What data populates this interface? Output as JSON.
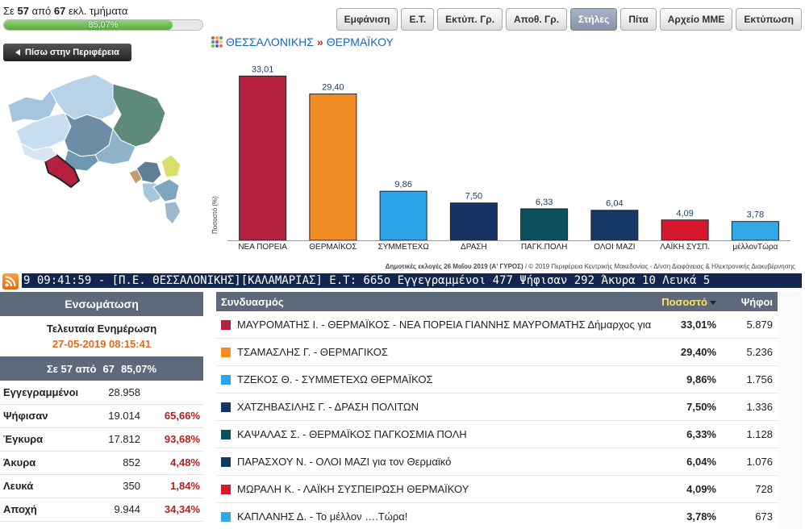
{
  "progress": {
    "prefix": "Σε",
    "counted": "57",
    "middle": "από",
    "total": "67",
    "suffix": "εκλ. τμήματα",
    "percent_label": "85,07%",
    "fraction": 0.8507
  },
  "toolbar": [
    {
      "label": "Εμφάνιση",
      "active": false
    },
    {
      "label": "Ε.Τ.",
      "active": false
    },
    {
      "label": "Εκτύπ. Γρ.",
      "active": false
    },
    {
      "label": "Αποθ. Γρ.",
      "active": false
    },
    {
      "label": "Στήλες",
      "active": true
    },
    {
      "label": "Πίτα",
      "active": false
    },
    {
      "label": "Αρχείο ΜΜΕ",
      "active": false
    },
    {
      "label": "Εκτύπωση",
      "active": false
    }
  ],
  "back_label": "Πίσω στην Περιφέρεια",
  "breadcrumb": {
    "region": "ΘΕΣΣΑΛΟΝΙΚΗΣ",
    "sep": "»",
    "municipality": "ΘΕΡΜΑΪΚΟΥ"
  },
  "chart_data": {
    "type": "bar",
    "categories": [
      "ΝΕΑ ΠΟΡΕΙΑ",
      "ΘΕΡΜΑΪΚΟΣ",
      "ΣΥΜΜΕΤΕΧΩ",
      "ΔΡΑΣΗ",
      "ΠΑΓΚ.ΠΟΛΗ",
      "ΟΛΟΙ ΜΑΖΙ",
      "ΛΑΪΚΗ ΣΥΣΠ.",
      "μέλλονΤώρα"
    ],
    "values": [
      33.01,
      29.4,
      9.86,
      7.5,
      6.33,
      6.04,
      4.09,
      3.78
    ],
    "value_labels": [
      "33,01",
      "29,40",
      "9,86",
      "7,50",
      "6,33",
      "6,04",
      "4,09",
      "3,78"
    ],
    "colors": [
      "#b5203f",
      "#f28c25",
      "#2ea4e8",
      "#173464",
      "#0c4f5e",
      "#163867",
      "#d6182e",
      "#32a8e6"
    ],
    "ylabel": "Ποσοστό (%)",
    "ylim": [
      0,
      35
    ]
  },
  "chart_footer": {
    "bold": "Δημοτικές εκλογές 26 Μαΐου 2019 (Α' ΓΥΡΟΣ)",
    "rest": " / © 2019 Περιφέρεια Κεντρικής Μακεδονίας - Δ/νση Διαφάνειας & Ηλεκτρονικής Διακυβέρνησης"
  },
  "ticker": "9 09:41:59 - [Π.Ε. ΘΕΣΣΑΛΟΝΙΚΗΣ][ΚΑΛΑΜΑΡΙΑΣ]  Ε.Τ: 665ο  Εγγεγραμμένοι 477  Ψήφισαν 292  Άκυρα 10  Λευκά 5",
  "left_panel": {
    "title": "Ενσωμάτωση",
    "update_title": "Τελευταία Ενημέρωση",
    "update_time": "27-05-2019 08:15:41",
    "summary": {
      "a": "Σε 57 από",
      "b": "67",
      "c": "85,07%"
    },
    "rows": [
      {
        "k": "Εγγεγραμμένοι",
        "v": "28.958",
        "p": ""
      },
      {
        "k": "Ψήφισαν",
        "v": "19.014",
        "p": "65,66%"
      },
      {
        "k": "Έγκυρα",
        "v": "17.812",
        "p": "93,68%"
      },
      {
        "k": "Άκυρα",
        "v": "852",
        "p": "4,48%"
      },
      {
        "k": "Λευκά",
        "v": "350",
        "p": "1,84%"
      },
      {
        "k": "Αποχή",
        "v": "9.944",
        "p": "34,34%"
      }
    ]
  },
  "results": {
    "headers": {
      "name": "Συνδυασμός",
      "percent": "Ποσοστό",
      "votes": "Ψήφοι"
    },
    "rows": [
      {
        "name": "ΜΑΥΡΟΜΑΤΗΣ Ι. - ΘΕΡΜΑΪΚΟΣ - ΝΕΑ ΠΟΡΕΙΑ ΓΙΑΝΝΗΣ ΜΑΥΡΟΜΑΤΗΣ Δήμαρχος για",
        "percent": "33,01%",
        "votes": "5.879",
        "color": "#b5203f"
      },
      {
        "name": "ΤΣΑΜΑΣΛΗΣ Γ. - ΘΕΡΜΑΓΙΚΟΣ",
        "percent": "29,40%",
        "votes": "5.236",
        "color": "#f28c25"
      },
      {
        "name": "ΤΖΕΚΟΣ Θ. - ΣΥΜΜΕΤΕΧΩ ΘΕΡΜΑΪΚΟΣ",
        "percent": "9,86%",
        "votes": "1.756",
        "color": "#2ea4e8"
      },
      {
        "name": "ΧΑΤΖΗΒΑΣΙΛΗΣ Γ. - ΔΡΑΣΗ ΠΟΛΙΤΩΝ",
        "percent": "7,50%",
        "votes": "1.336",
        "color": "#173464"
      },
      {
        "name": "ΚΑΨΑΛΑΣ Σ. - ΘΕΡΜΑΪΚΟΣ ΠΑΓΚΟΣΜΙΑ ΠΟΛΗ",
        "percent": "6,33%",
        "votes": "1.128",
        "color": "#0c4f5e"
      },
      {
        "name": "ΠΑΡΑΣΧΟΥ Ν. - ΟΛΟΙ ΜΑΖΙ για τον Θερμαϊκό",
        "percent": "6,04%",
        "votes": "1.076",
        "color": "#163867"
      },
      {
        "name": "ΜΩΡΑΛΗ Κ. - ΛΑΪΚΗ ΣΥΣΠΕΙΡΩΣΗ ΘΕΡΜΑΪΚΟΥ",
        "percent": "4,09%",
        "votes": "728",
        "color": "#d6182e"
      },
      {
        "name": "ΚΑΠΛΑΝΗΣ Δ. - Το μέλλον ….Τώρα!",
        "percent": "3,78%",
        "votes": "673",
        "color": "#32a8e6"
      }
    ]
  }
}
